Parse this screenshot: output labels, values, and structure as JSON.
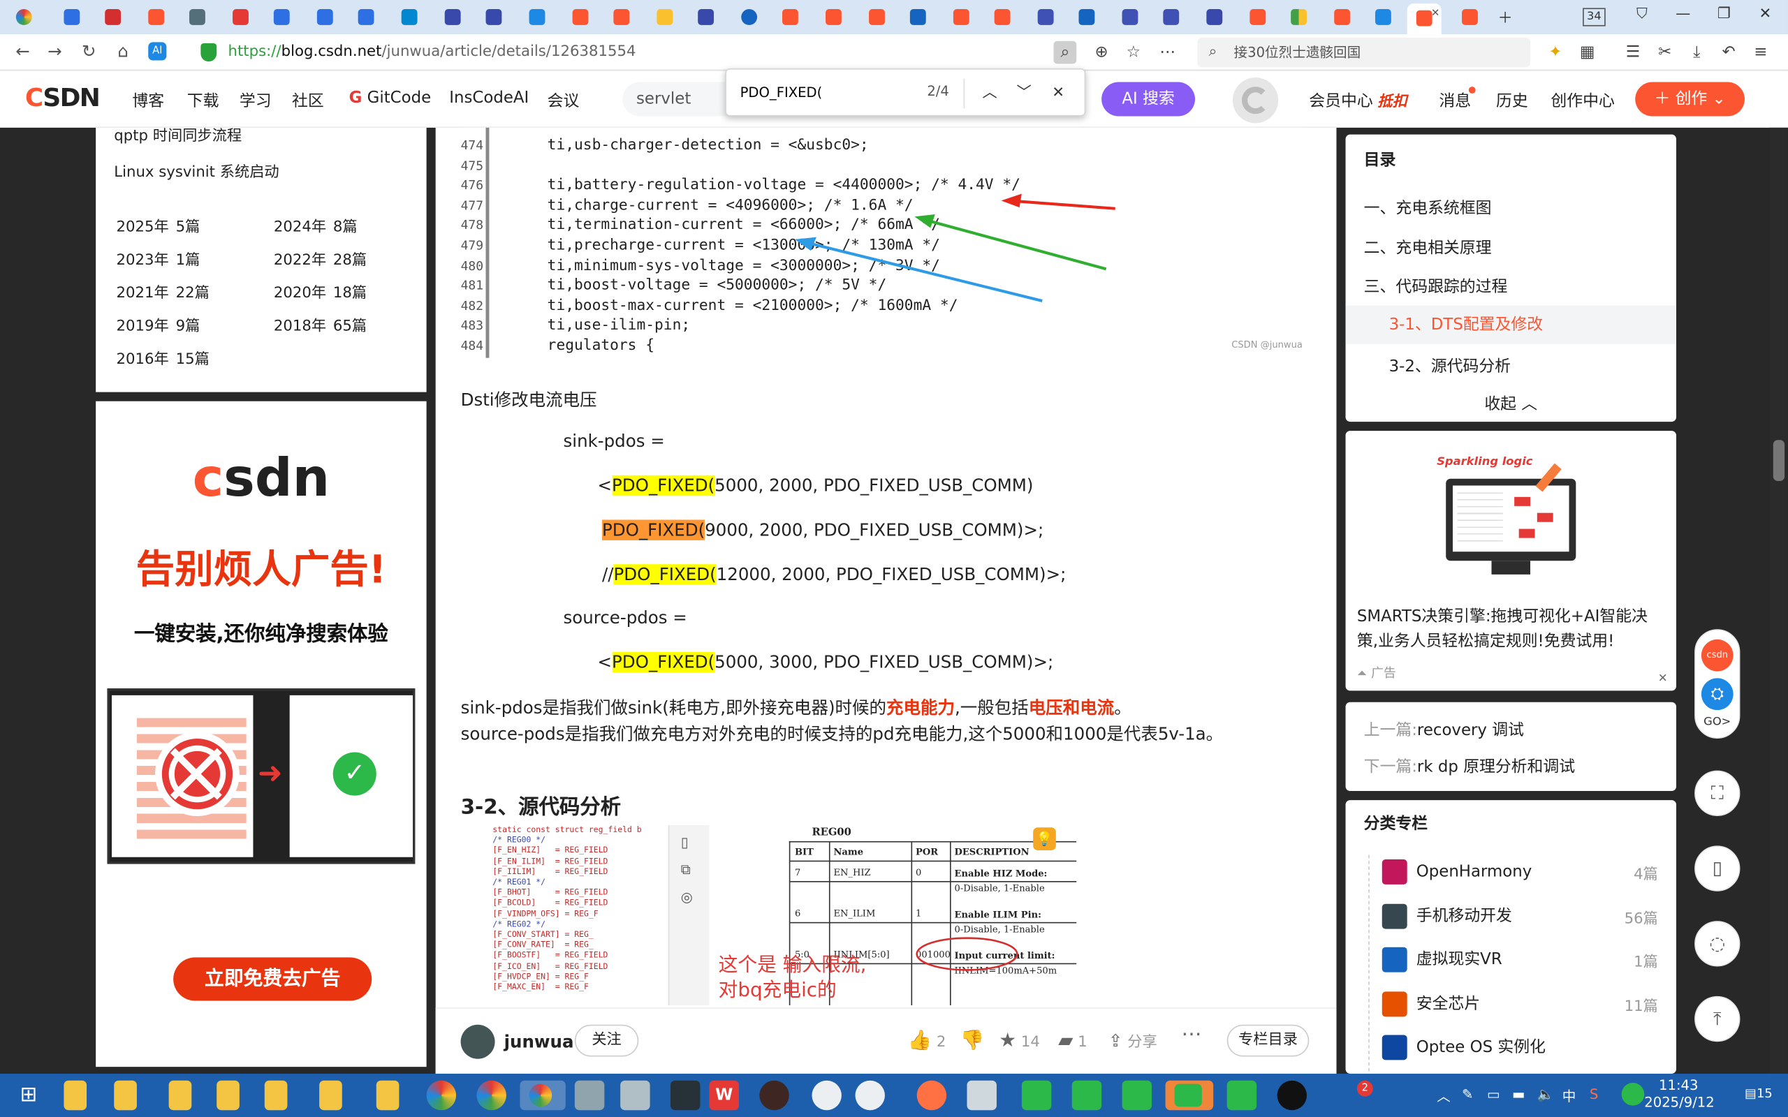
{
  "browser": {
    "tab_badge": "34",
    "url_scheme": "https://",
    "url_host": "blog.csdn.net",
    "url_path": "/junwua/article/details/126381554",
    "search_placeholder": "接30位烈士遗骸回国"
  },
  "find": {
    "query": "PDO_FIXED(",
    "count": "2/4"
  },
  "header": {
    "logo_c": "C",
    "logo_rest": "SDN",
    "nav": [
      "博客",
      "下载",
      "学习",
      "社区",
      "GitCode",
      "InsCodeAI",
      "会议"
    ],
    "search_value": "servlet",
    "ai_search": "AI 搜索",
    "right_nav": [
      "会员中心",
      "消息",
      "历史",
      "创作中心"
    ],
    "vip_badge": "抵扣",
    "create_label": "创作"
  },
  "left": {
    "links": [
      "qptp 时间同步流程",
      "Linux sysvinit 系统启动"
    ],
    "archive": [
      {
        "year": "2025年",
        "count": "5篇"
      },
      {
        "year": "2024年",
        "count": "8篇"
      },
      {
        "year": "2023年",
        "count": "1篇"
      },
      {
        "year": "2022年",
        "count": "28篇"
      },
      {
        "year": "2021年",
        "count": "22篇"
      },
      {
        "year": "2020年",
        "count": "18篇"
      },
      {
        "year": "2019年",
        "count": "9篇"
      },
      {
        "year": "2018年",
        "count": "65篇"
      },
      {
        "year": "2016年",
        "count": "15篇"
      }
    ],
    "ad": {
      "logo_c": "c",
      "logo_rest": "sdn",
      "headline": "告别烦人广告!",
      "sub": "一键安装,还你纯净搜索体验",
      "button": "立即免费去广告"
    }
  },
  "article": {
    "code_lines": [
      {
        "n": "474",
        "t": "ti,usb-charger-detection = <&usbc0>;"
      },
      {
        "n": "475",
        "t": ""
      },
      {
        "n": "476",
        "t": "ti,battery-regulation-voltage = <4400000>; /* 4.4V */"
      },
      {
        "n": "477",
        "t": "ti,charge-current = <4096000>; /* 1.6A */"
      },
      {
        "n": "478",
        "t": "ti,termination-current = <66000>; /* 66mA */"
      },
      {
        "n": "479",
        "t": "ti,precharge-current = <130000>; /* 130mA */"
      },
      {
        "n": "480",
        "t": "ti,minimum-sys-voltage = <3000000>; /* 3V */"
      },
      {
        "n": "481",
        "t": "ti,boost-voltage = <5000000>; /* 5V */"
      },
      {
        "n": "482",
        "t": "ti,boost-max-current = <2100000>; /* 1600mA */"
      },
      {
        "n": "483",
        "t": "ti,use-ilim-pin;"
      },
      {
        "n": "484",
        "t": "regulators {"
      }
    ],
    "watermark": "CSDN @junwua",
    "p_intro": "Dsti修改电流电压",
    "sink_label": "sink-pdos =",
    "pdo_key": "PDO_FIXED(",
    "line1_pre": "<",
    "line1_rest": "5000, 2000, PDO_FIXED_USB_COMM)",
    "line2_rest": "9000, 2000, PDO_FIXED_USB_COMM)>;",
    "line3_pre": "//",
    "line3_rest": "12000, 2000, PDO_FIXED_USB_COMM)>;",
    "source_label": "source-pdos =",
    "line4_pre": "<",
    "line4_rest": "5000, 3000, PDO_FIXED_USB_COMM)>;",
    "para_a1": "sink-pdos是指我们做sink(耗电方,即外接充电器)时候的",
    "para_a2": "充电能力",
    "para_a3": ",一般包括",
    "para_a4": "电压和电流",
    "para_a5": "。",
    "para_b": "source-pods是指我们做充电方对外充电的时候支持的pd充电能力,这个5000和1000是代表5v-1a。",
    "h3": "3-2、源代码分析",
    "img2": {
      "code": [
        "static const struct reg_field b",
        "/* REG00 */",
        "[F_EN_HIZ]   = REG_FIELD",
        "[F_EN_ILIM]  = REG_FIELD",
        "[F_IILIM]    = REG_FIELD",
        "/* REG01 */",
        "[F_BHOT]     = REG_FIELD",
        "[F_BCOLD]    = REG_FIELD",
        "[F_VINDPM_OFS] = REG_F",
        "/* REG02 */",
        "[F_CONV_START] = REG_",
        "[F_CONV_RATE]  = REG_",
        "[F_BOOSTF]   = REG_FIELD",
        "[F_ICO_EN]   = REG_FIELD",
        "[F_HVDCP_EN] = REG_F",
        "[F_MAXC_EN]  = REG_F"
      ],
      "table_title": "REG00",
      "headers": [
        "BIT",
        "Name",
        "POR",
        "DESCRIPTION"
      ],
      "rows": [
        [
          "7",
          "EN_HIZ",
          "0",
          "Enable HIZ Mode:",
          "0-Disable, 1-Enable"
        ],
        [
          "6",
          "EN_ILIM",
          "1",
          "Enable ILIM Pin:",
          "0-Disable, 1-Enable"
        ],
        [
          "5:0",
          "IINLIM[5:0]",
          "001000",
          "Input current limit:",
          "IINLIM=100mA+50m"
        ]
      ],
      "annotation1": "这个是 输入限流,",
      "annotation2": "对bq充电ic的"
    }
  },
  "bottombar": {
    "author": "junwua",
    "follow": "关注",
    "likes": "2",
    "favorites": "14",
    "comments": "1",
    "share": "分享",
    "toc": "专栏目录"
  },
  "toc": {
    "title": "目录",
    "items": [
      "一、充电系统框图",
      "二、充电相关原理",
      "三、代码跟踪的过程",
      "3-1、DTS配置及修改",
      "3-2、源代码分析"
    ],
    "collapse": "收起"
  },
  "ad_right": {
    "brand": "Sparkling logic",
    "text": "SMARTS决策引擎:拖拽可视化+AI智能决策,业务人员轻松搞定规则!免费试用!",
    "tag": "广告"
  },
  "prevnext": {
    "prev_label": "上一篇:",
    "prev_title": "recovery 调试",
    "next_label": "下一篇:",
    "next_title": "rk dp 原理分析和调试"
  },
  "categories": {
    "title": "分类专栏",
    "items": [
      {
        "name": "OpenHarmony",
        "count": "4篇",
        "color": "#c2185b"
      },
      {
        "name": "手机移动开发",
        "count": "56篇",
        "color": "#37474f"
      },
      {
        "name": "虚拟现实VR",
        "count": "1篇",
        "color": "#1565c0"
      },
      {
        "name": "安全芯片",
        "count": "11篇",
        "color": "#e65100"
      },
      {
        "name": "Optee OS 实例化",
        "count": "",
        "color": "#0d47a1"
      }
    ]
  },
  "float_tools": {
    "csdn": "csdn",
    "go": "GO>"
  },
  "taskbar": {
    "time": "11:43",
    "date": "2025/9/12",
    "ime": "中",
    "notify": "15",
    "badge": "2"
  },
  "colors": {
    "brand": "#fc5531",
    "ai": "#8a5cf6",
    "highlight": "#ffff00",
    "highlight_current": "#ff9632",
    "taskbar": "#1e5fad"
  }
}
